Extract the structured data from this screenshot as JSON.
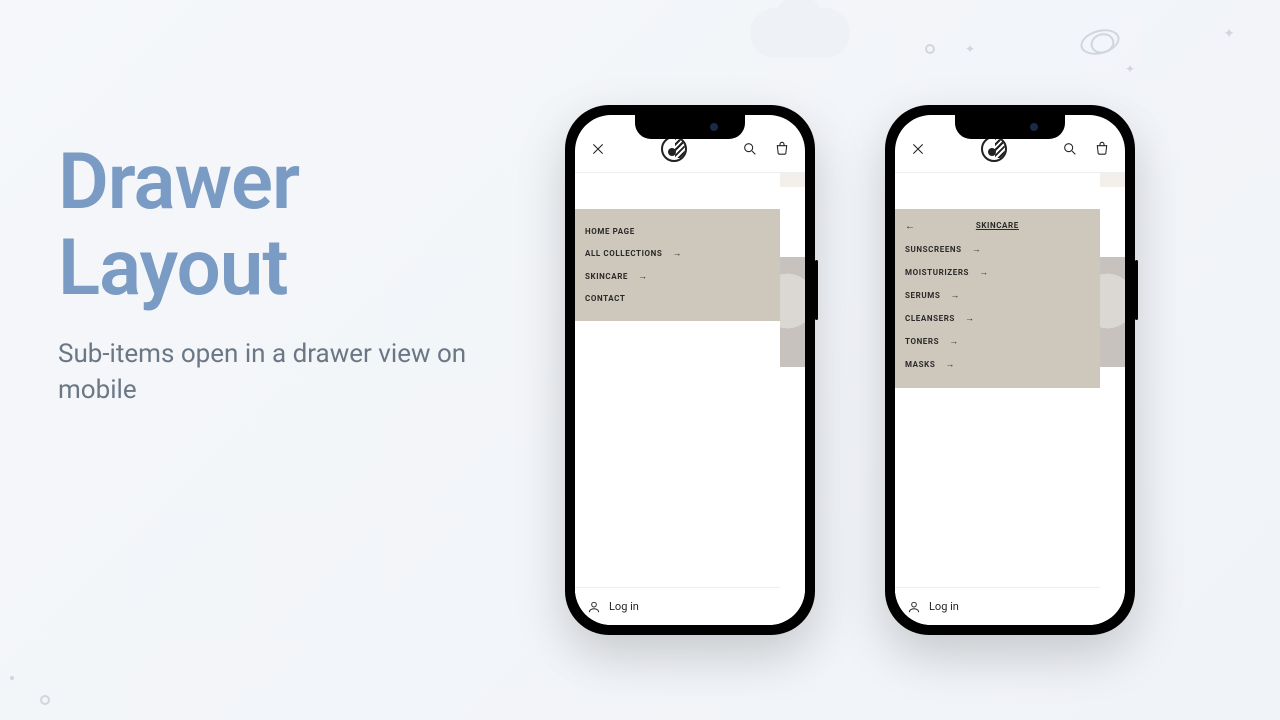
{
  "text": {
    "title": "Drawer Layout",
    "subtitle": "Sub-items open in a drawer view on mobile"
  },
  "phoneA": {
    "menu": {
      "items": [
        {
          "label": "HOME PAGE",
          "hasChildren": false
        },
        {
          "label": "ALL COLLECTIONS",
          "hasChildren": true
        },
        {
          "label": "SKINCARE",
          "hasChildren": true
        },
        {
          "label": "CONTACT",
          "hasChildren": false
        }
      ]
    },
    "login": "Log in"
  },
  "phoneB": {
    "menu": {
      "parent": "SKINCARE",
      "items": [
        {
          "label": "SUNSCREENS",
          "hasChildren": true
        },
        {
          "label": "MOISTURIZERS",
          "hasChildren": true
        },
        {
          "label": "SERUMS",
          "hasChildren": true
        },
        {
          "label": "CLEANSERS",
          "hasChildren": true
        },
        {
          "label": "TONERS",
          "hasChildren": true
        },
        {
          "label": "MASKS",
          "hasChildren": true
        }
      ]
    },
    "login": "Log in"
  }
}
